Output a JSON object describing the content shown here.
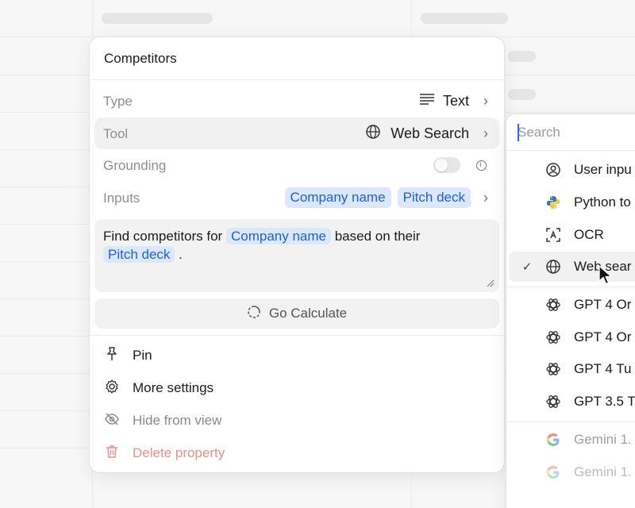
{
  "panel": {
    "title": "Competitors",
    "rows": {
      "type": {
        "label": "Type",
        "value": "Text"
      },
      "tool": {
        "label": "Tool",
        "value": "Web Search"
      },
      "grounding": {
        "label": "Grounding",
        "enabled": false
      },
      "inputs": {
        "label": "Inputs",
        "chips": [
          "Company name",
          "Pitch deck"
        ]
      }
    },
    "prompt": {
      "text_1": "Find competitors for",
      "chip_1": "Company name",
      "text_2": "based on their",
      "chip_2": "Pitch deck",
      "text_3": "."
    },
    "calculate_label": "Go Calculate",
    "menu": {
      "pin": "Pin",
      "more_settings": "More settings",
      "hide": "Hide from view",
      "delete": "Delete property"
    }
  },
  "dropdown": {
    "search_placeholder": "Search",
    "items": [
      {
        "label": "User inpu",
        "icon": "user-circle-icon"
      },
      {
        "label": "Python to",
        "icon": "python-icon"
      },
      {
        "label": "OCR",
        "icon": "scan-text-icon"
      },
      {
        "label": "Web sear",
        "icon": "globe-icon",
        "selected": true
      }
    ],
    "models": [
      {
        "label": "GPT 4 Or",
        "icon": "openai-icon"
      },
      {
        "label": "GPT 4 Or",
        "icon": "openai-icon"
      },
      {
        "label": "GPT 4 Tu",
        "icon": "openai-icon"
      },
      {
        "label": "GPT 3.5 T",
        "icon": "openai-icon"
      }
    ],
    "google_models": [
      {
        "label": "Gemini 1.",
        "icon": "google-icon"
      },
      {
        "label": "Gemini 1.",
        "icon": "google-icon"
      }
    ]
  },
  "colors": {
    "chip_bg": "#dbe8fb",
    "chip_text": "#1f5fd6",
    "danger": "#ef8c8c",
    "accent": "#2f6ae0"
  }
}
